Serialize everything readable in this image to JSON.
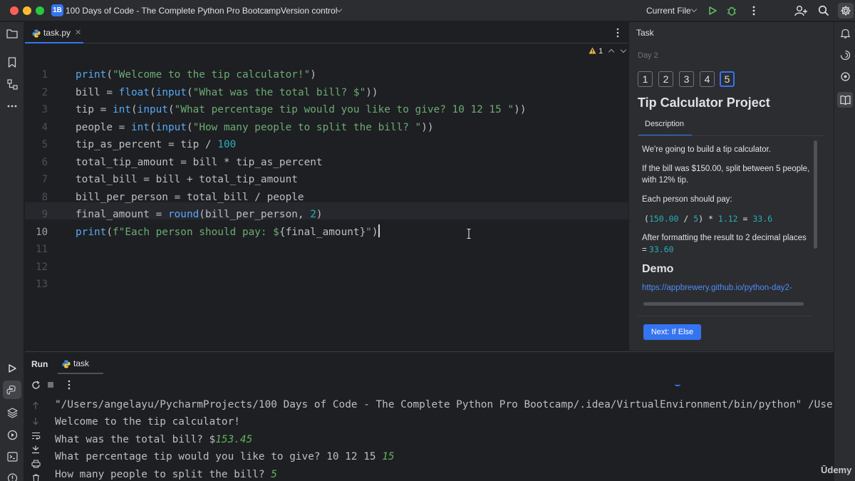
{
  "titlebar": {
    "project_badge": "1B",
    "project_name": "100 Days of Code - The Complete Python Pro Bootcamp",
    "vcs_label": "Version control",
    "run_config": "Current File"
  },
  "editor": {
    "tab_label": "task.py",
    "warning_count": "1",
    "lines": [
      {
        "n": "1"
      },
      {
        "n": "2"
      },
      {
        "n": "3"
      },
      {
        "n": "4"
      },
      {
        "n": "5"
      },
      {
        "n": "6"
      },
      {
        "n": "7"
      },
      {
        "n": "8"
      },
      {
        "n": "9"
      },
      {
        "n": "10"
      },
      {
        "n": "11"
      },
      {
        "n": "12"
      },
      {
        "n": "13"
      }
    ],
    "code": {
      "l1_fn": "print",
      "l1_str": "\"Welcome to the tip calculator!\"",
      "l2_var": "bill = ",
      "l2_fn": "float",
      "l2_in": "input",
      "l2_str": "\"What was the total bill? $\"",
      "l3_var": "tip = ",
      "l3_fn": "int",
      "l3_in": "input",
      "l3_str": "\"What percentage tip would you like to give? 10 12 15 \"",
      "l4_var": "people = ",
      "l4_fn": "int",
      "l4_in": "input",
      "l4_str": "\"How many people to split the bill? \"",
      "l5_a": "tip_as_percent = tip / ",
      "l5_num": "100",
      "l6": "total_tip_amount = bill * tip_as_percent",
      "l7": "total_bill = bill + total_tip_amount",
      "l8": "bill_per_person = total_bill / people",
      "l9_a": "final_amount = ",
      "l9_fn": "round",
      "l9_b": "(bill_per_person, ",
      "l9_num": "2",
      "l9_c": ")",
      "l10_fn": "print",
      "l10_str_a": "f\"Each person should pay: $",
      "l10_expr": "{final_amount}",
      "l10_str_b": "\""
    }
  },
  "task": {
    "panel_title": "Task",
    "day": "Day 2",
    "steps": [
      "1",
      "2",
      "3",
      "4",
      "5"
    ],
    "title": "Tip Calculator Project",
    "desc_tab": "Description",
    "p1": "We're going to build a tip calculator.",
    "p2": "If the bill was $150.00, split between 5 people, with 12% tip.",
    "p3": "Each person should pay:",
    "calc_n1": "150.00",
    "calc_op1": " / ",
    "calc_n2": "5",
    "calc_op2": ") * ",
    "calc_n3": "1.12",
    "calc_op3": " = ",
    "calc_n4": "33.6",
    "p4": "After formatting the result to 2 decimal places =",
    "p4_num": "33.60",
    "demo_heading": "Demo",
    "demo_link": "https://appbrewery.github.io/python-day2-",
    "next_button": "Next: If Else"
  },
  "run": {
    "label": "Run",
    "tab_label": "task",
    "console": {
      "l1": "\"/Users/angelayu/PycharmProjects/100 Days of Code - The Complete Python Pro Bootcamp/.idea/VirtualEnvironment/bin/python\" /Users",
      "l2": "Welcome to the tip calculator!",
      "l3_prompt": "What was the total bill? $",
      "l3_input": "153.45",
      "l4_prompt": "What percentage tip would you like to give? 10 12 15 ",
      "l4_input": "15",
      "l5_prompt": "How many people to split the bill? ",
      "l5_input": "5"
    }
  },
  "watermark": "Ūdemy"
}
